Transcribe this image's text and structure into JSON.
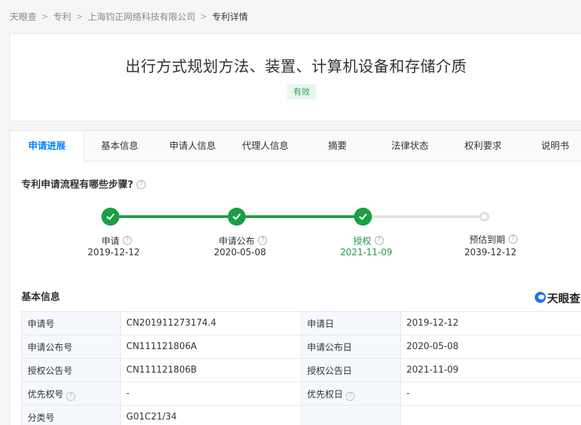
{
  "breadcrumb": [
    {
      "label": "天眼查"
    },
    {
      "label": "专利"
    },
    {
      "label": "上海钧正网络科技有限公司"
    },
    {
      "label": "专利详情"
    }
  ],
  "patent": {
    "title": "出行方式规划方法、装置、计算机设备和存储介质",
    "status": "有效"
  },
  "tabs": [
    {
      "label": "申请进展"
    },
    {
      "label": "基本信息"
    },
    {
      "label": "申请人信息"
    },
    {
      "label": "代理人信息"
    },
    {
      "label": "摘要"
    },
    {
      "label": "法律状态"
    },
    {
      "label": "权利要求"
    },
    {
      "label": "说明书"
    }
  ],
  "process": {
    "question": "专利申请流程有哪些步骤?",
    "steps": [
      {
        "label": "申请",
        "date": "2019-12-12",
        "state": "done"
      },
      {
        "label": "申请公布",
        "date": "2020-05-08",
        "state": "done"
      },
      {
        "label": "授权",
        "date": "2021-11-09",
        "state": "current"
      },
      {
        "label": "预估到期",
        "date": "2039-12-12",
        "state": "pending"
      }
    ]
  },
  "basic": {
    "title": "基本信息",
    "logo": "天眼查",
    "rows": [
      {
        "k1": "申请号",
        "v1": "CN201911273174.4",
        "k2": "申请日",
        "v2": "2019-12-12"
      },
      {
        "k1": "申请公布号",
        "v1": "CN111121806A",
        "k2": "申请公布日",
        "v2": "2020-05-08"
      },
      {
        "k1": "授权公告号",
        "v1": "CN111121806B",
        "k2": "授权公告日",
        "v2": "2021-11-09"
      },
      {
        "k1": "优先权号",
        "v1": "-",
        "k2": "优先权日",
        "v2": "-"
      },
      {
        "k1": "分类号",
        "v1": "G01C21/34",
        "k2": "",
        "v2": ""
      }
    ]
  },
  "colors": {
    "accent": "#0084ff",
    "success": "#1a9f45",
    "badge_bg": "#e9f6ee"
  },
  "icons": {
    "breadcrumb_separator": "chevron-right-icon",
    "help": "question-circle-icon",
    "step_done": "check-circle-icon"
  }
}
